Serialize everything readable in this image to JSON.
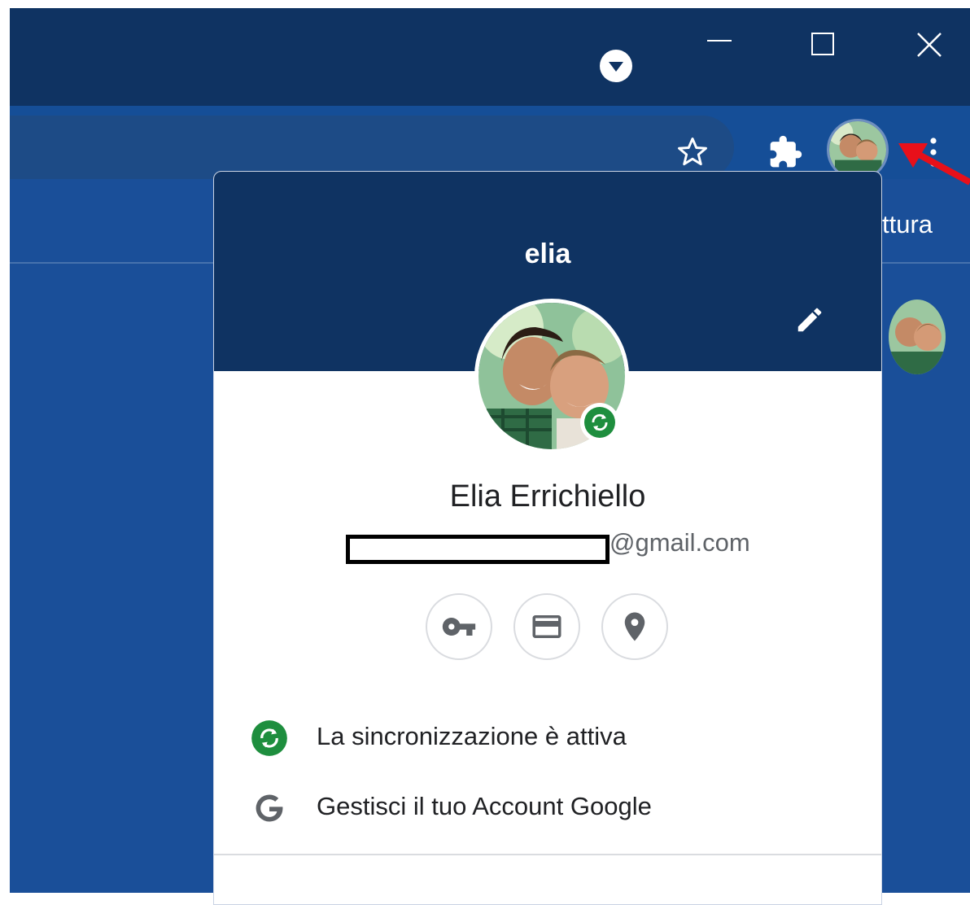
{
  "window": {
    "minimize_icon": "minimize-icon",
    "maximize_icon": "maximize-icon",
    "close_icon": "close-icon",
    "tab_search_icon": "dropdown-circle-icon"
  },
  "toolbar": {
    "bookmark_icon": "star-icon",
    "extensions_icon": "puzzle-icon",
    "menu_icon": "vertical-dots-icon"
  },
  "page": {
    "partial_text": "ttura"
  },
  "profile_menu": {
    "profile_name": "elia",
    "full_name": "Elia Errichiello",
    "email_suffix": "@gmail.com",
    "quick_actions": [
      {
        "icon": "key-icon",
        "name": "passwords"
      },
      {
        "icon": "credit-card-icon",
        "name": "payment-methods"
      },
      {
        "icon": "location-pin-icon",
        "name": "addresses"
      }
    ],
    "sync_status": "La sincronizzazione è attiva",
    "manage_account": "Gestisci il tuo Account Google"
  },
  "colors": {
    "titlebar": "#0f3362",
    "toolbar": "#154e97",
    "content": "#1a4f99",
    "sync_green": "#1e8e3e",
    "annotation_arrow": "#e8101a"
  }
}
